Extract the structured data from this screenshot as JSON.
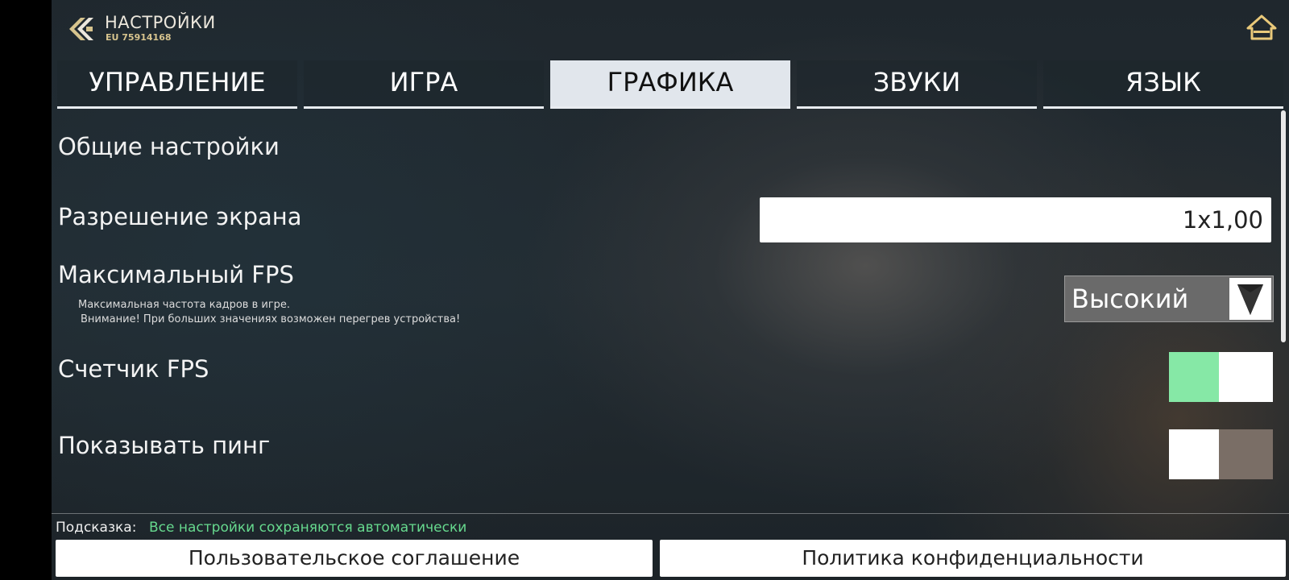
{
  "header": {
    "title": "НАСТРОЙКИ",
    "subtitle": "EU 75914168",
    "back_icon": "double-chevron-left-icon",
    "home_icon": "home-icon",
    "accent_color": "#d7c48e"
  },
  "tabs": [
    {
      "label": "УПРАВЛЕНИЕ",
      "active": false
    },
    {
      "label": "ИГРА",
      "active": false
    },
    {
      "label": "ГРАФИКА",
      "active": true
    },
    {
      "label": "ЗВУКИ",
      "active": false
    },
    {
      "label": "ЯЗЫК",
      "active": false
    }
  ],
  "content": {
    "section_title": "Общие настройки",
    "resolution": {
      "label": "Разрешение экрана",
      "value": "1x1,00"
    },
    "max_fps": {
      "label": "Максимальный FPS",
      "hint_line1": "Максимальная частота кадров в игре.",
      "hint_line2": "Внимание! При больших значениях возможен перегрев устройства!",
      "selected": "Высокий",
      "arrow_icon": "triangle-down-icon"
    },
    "fps_counter": {
      "label": "Счетчик FPS",
      "on": true,
      "on_color": "#86e8a6"
    },
    "show_ping": {
      "label": "Показывать пинг",
      "on": false,
      "off_color": "#7a6e66"
    }
  },
  "footer": {
    "hint_label": "Подсказка:",
    "hint_text": "Все настройки сохраняются автоматически",
    "hint_color": "#66d98e",
    "agreement_button": "Пользовательское соглашение",
    "privacy_button": "Политика конфиденциальности"
  }
}
